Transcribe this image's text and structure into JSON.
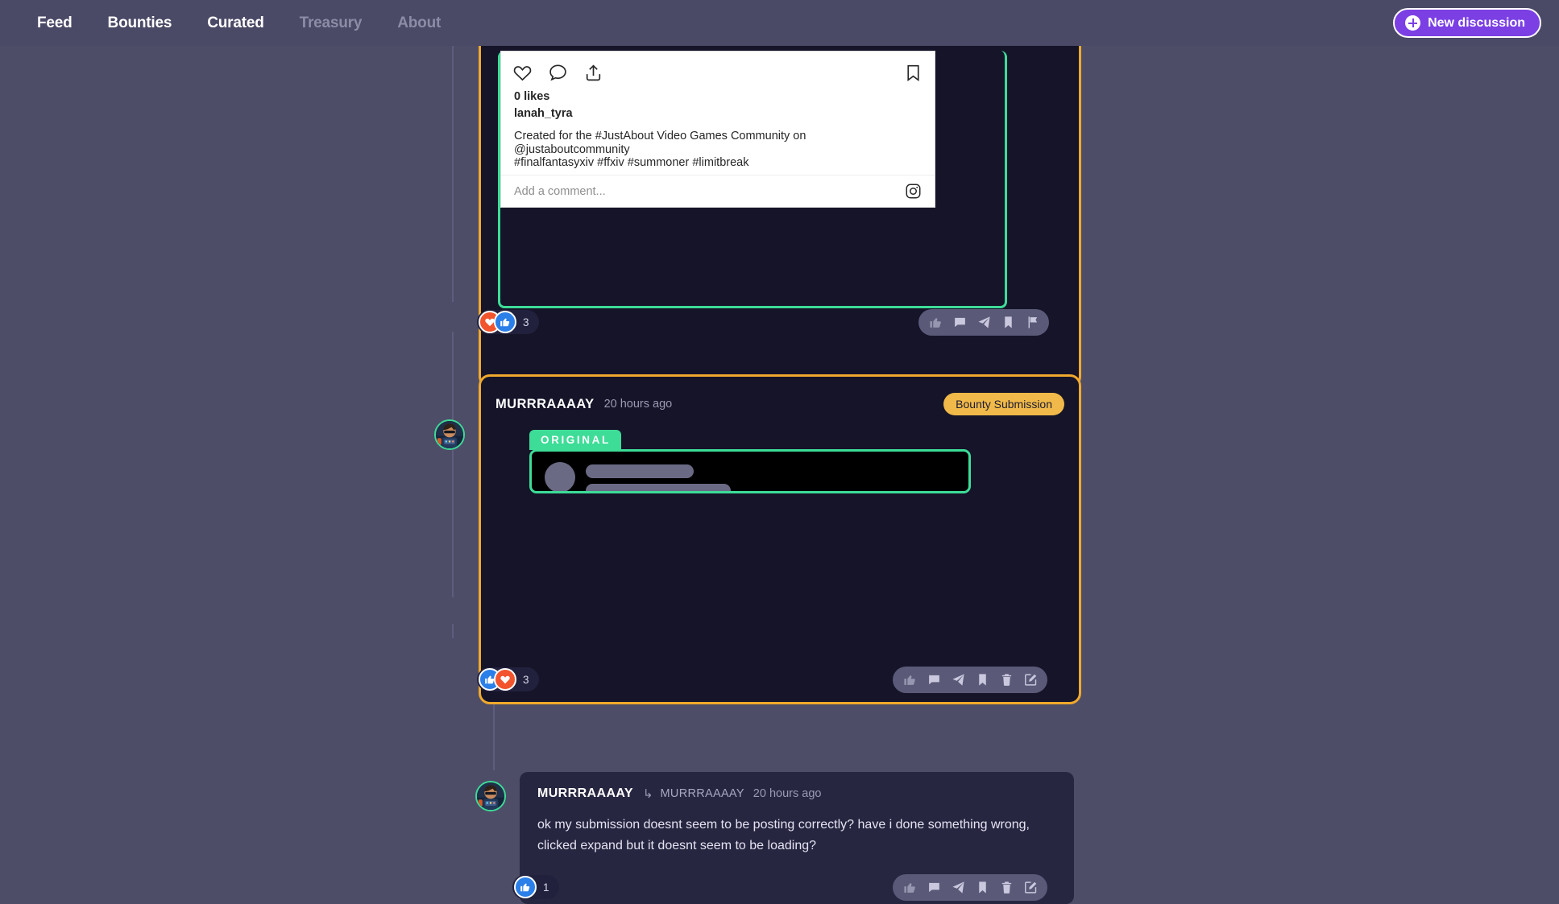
{
  "nav": {
    "links": [
      {
        "label": "Feed",
        "active": true
      },
      {
        "label": "Bounties",
        "active": true
      },
      {
        "label": "Curated",
        "active": true
      },
      {
        "label": "Treasury",
        "active": false
      },
      {
        "label": "About",
        "active": false
      }
    ],
    "new_discussion_label": "New discussion",
    "accent_color": "#7b3fe4"
  },
  "colors": {
    "page_background": "#4e4d68",
    "navbar_background": "#4a4966",
    "post_background": "#151429",
    "post_border": "#f0a92c",
    "original_green": "#3ddc97",
    "bounty_amber": "#f0b949",
    "reaction_heart": "#f2542d",
    "reaction_thumb": "#2b7fe8",
    "comment_background": "#272641"
  },
  "post_one": {
    "embed": {
      "platform": "instagram",
      "likes": "0 likes",
      "username": "lanah_tyra",
      "caption_line_1": "Created for the #JustAbout Video Games Community on @justaboutcommunity",
      "caption_line_2": "#finalfantasyxiv #ffxiv #summoner #limitbreak",
      "comment_placeholder": "Add a comment...",
      "icons": [
        "heart-icon",
        "comment-icon",
        "share-icon",
        "bookmark-icon",
        "instagram-icon"
      ]
    },
    "reactions": {
      "items": [
        {
          "type": "heart",
          "name": "reaction-heart"
        },
        {
          "type": "thumb",
          "name": "reaction-thumbs-up"
        }
      ],
      "count": "3"
    },
    "actions": [
      {
        "name": "like-button",
        "icon": "thumbs-up-icon",
        "dim": true
      },
      {
        "name": "comment-button",
        "icon": "comment-icon",
        "dim": false
      },
      {
        "name": "share-button",
        "icon": "send-icon",
        "dim": false
      },
      {
        "name": "bookmark-button",
        "icon": "bookmark-icon",
        "dim": false
      },
      {
        "name": "report-button",
        "icon": "flag-icon",
        "dim": false
      }
    ]
  },
  "post_two": {
    "author": "MURRRAAAAY",
    "timestamp": "20 hours ago",
    "badge": "Bounty Submission",
    "original_badge": "ORIGINAL",
    "reactions": {
      "items": [
        {
          "type": "thumb",
          "name": "reaction-thumbs-up"
        },
        {
          "type": "heart",
          "name": "reaction-heart"
        }
      ],
      "count": "3"
    },
    "actions": [
      {
        "name": "like-button",
        "icon": "thumbs-up-icon",
        "dim": true
      },
      {
        "name": "comment-button",
        "icon": "comment-icon",
        "dim": false
      },
      {
        "name": "share-button",
        "icon": "send-icon",
        "dim": false
      },
      {
        "name": "bookmark-button",
        "icon": "bookmark-icon",
        "dim": false
      },
      {
        "name": "delete-button",
        "icon": "trash-icon",
        "dim": false
      },
      {
        "name": "edit-button",
        "icon": "edit-icon",
        "dim": false
      }
    ]
  },
  "comment": {
    "author": "MURRRAAAAY",
    "reply_arrow": "↳",
    "parent_author": "MURRRAAAAY",
    "timestamp": "20 hours ago",
    "body": "ok my submission doesnt seem to be posting correctly? have i done something wrong, clicked expand but it doesnt seem to be loading?",
    "reactions": {
      "items": [
        {
          "type": "thumb",
          "name": "reaction-thumbs-up"
        }
      ],
      "count": "1"
    },
    "actions": [
      {
        "name": "like-button",
        "icon": "thumbs-up-icon",
        "dim": true
      },
      {
        "name": "comment-button",
        "icon": "comment-icon",
        "dim": false
      },
      {
        "name": "share-button",
        "icon": "send-icon",
        "dim": false
      },
      {
        "name": "bookmark-button",
        "icon": "bookmark-icon",
        "dim": false
      },
      {
        "name": "delete-button",
        "icon": "trash-icon",
        "dim": false
      },
      {
        "name": "edit-button",
        "icon": "edit-icon",
        "dim": false
      }
    ]
  }
}
